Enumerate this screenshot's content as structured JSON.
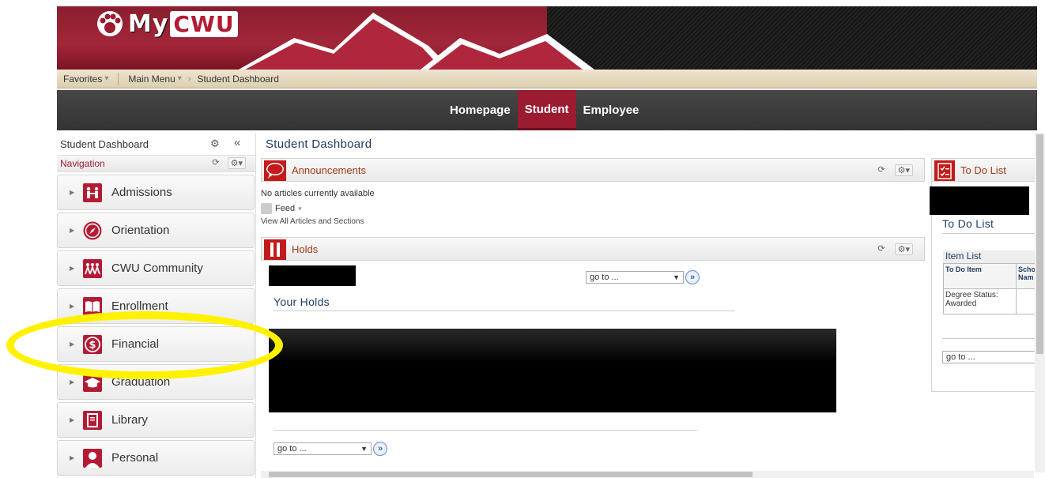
{
  "banner": {
    "logo_my": "My",
    "logo_cwu": "CWU"
  },
  "breadcrumbs": {
    "favorites": "Favorites",
    "main_menu": "Main Menu",
    "current": "Student Dashboard"
  },
  "navbar": {
    "tabs": [
      {
        "label": "Homepage",
        "active": false
      },
      {
        "label": "Student",
        "active": true
      },
      {
        "label": "Employee",
        "active": false
      }
    ]
  },
  "sidebar": {
    "title": "Student Dashboard",
    "section": "Navigation",
    "items": [
      {
        "label": "Admissions",
        "icon": "admissions-icon"
      },
      {
        "label": "Orientation",
        "icon": "compass-icon"
      },
      {
        "label": "CWU Community",
        "icon": "community-icon"
      },
      {
        "label": "Enrollment",
        "icon": "book-icon"
      },
      {
        "label": "Financial",
        "icon": "dollar-icon"
      },
      {
        "label": "Graduation",
        "icon": "graduation-cap-icon"
      },
      {
        "label": "Library",
        "icon": "library-icon"
      },
      {
        "label": "Personal",
        "icon": "person-icon"
      }
    ]
  },
  "main": {
    "title": "Student Dashboard",
    "announcements": {
      "title": "Announcements",
      "empty_text": "No articles currently available",
      "feed_label": "Feed",
      "view_all": "View All Articles and Sections"
    },
    "holds": {
      "title": "Holds",
      "goto_label": "go to ...",
      "your_holds": "Your Holds"
    }
  },
  "todo": {
    "header": "To Do List",
    "title": "To Do List",
    "item_list": "Item List",
    "columns": [
      "To Do Item",
      "Scho Nam"
    ],
    "rows": [
      [
        "Degree Status: Awarded",
        ""
      ]
    ],
    "goto_label": "go to ..."
  },
  "colors": {
    "brand_red": "#9b1b30",
    "highlight": "#fff200"
  }
}
